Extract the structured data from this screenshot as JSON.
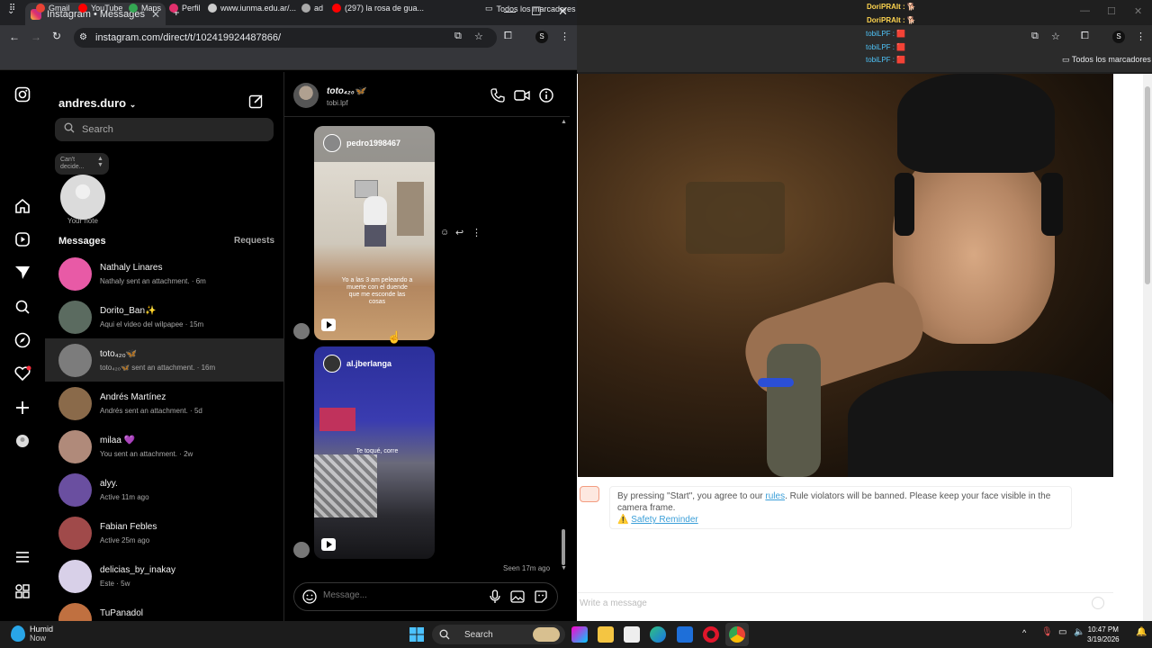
{
  "browser_left": {
    "tab_title": "Instagram • Messages",
    "url": "instagram.com/direct/t/102419924487866/",
    "bookmarks": [
      "Gmail",
      "YouTube",
      "Maps",
      "Perfil",
      "www.iunma.edu.ar/...",
      "ad",
      "(297) la rosa de gua...",
      "Todos los marcadores"
    ]
  },
  "instagram": {
    "account": "andres.duro",
    "search_placeholder": "Search",
    "note_bubble": "Can't decide...",
    "note_label": "Your note",
    "messages_header": "Messages",
    "requests_label": "Requests",
    "conversations": [
      {
        "name": "Nathaly Linares",
        "preview": "Nathaly sent an attachment. · 6m",
        "color": "#e85aa6"
      },
      {
        "name": "Dorito_Ban✨",
        "preview": "Aqui el video del wilpapee · 15m",
        "color": "#5b6b60"
      },
      {
        "name": "toto₄₂₀🦋",
        "preview": "toto₄₂₀🦋 sent an attachment. · 16m",
        "color": "#7c7c7c"
      },
      {
        "name": "Andrés Martínez",
        "preview": "Andrés sent an attachment. · 5d",
        "color": "#8a6a4a"
      },
      {
        "name": "milaa 💜",
        "preview": "You sent an attachment. · 2w",
        "color": "#b08a7a"
      },
      {
        "name": "alyy.",
        "preview": "Active 11m ago",
        "color": "#6a4fa0"
      },
      {
        "name": "Fabian Febles",
        "preview": "Active 25m ago",
        "color": "#a04a4a"
      },
      {
        "name": "delicias_by_inakay",
        "preview": "Este · 5w",
        "color": "#d8d0e8"
      },
      {
        "name": "TuPanadol",
        "preview": "",
        "color": "#c07040"
      }
    ],
    "chat": {
      "name": "toto₄₂₀🦋",
      "handle": "tobi.lpf",
      "reel1_user": "pedro1998467",
      "reel1_caption": "Yo a las 3 am peleando a muerte con el duende que me esconde las cosas",
      "reel2_user": "al.jberlanga",
      "reel2_caption": "Te toqué, corre",
      "seen": "Seen 17m ago",
      "input_placeholder": "Message..."
    }
  },
  "browser_right": {
    "overlay": [
      "DoriPRAIt : 🐕",
      "DoriPRAIt : 🐕",
      "tobiLPF : 🟥",
      "tobiLPF : 🟥",
      "tobiLPF : 🟥"
    ],
    "bookmark": "Todos los marcadores",
    "notice_pre": "By pressing \"Start\", you agree to our ",
    "notice_link": "rules",
    "notice_post": ". Rule violators will be banned. Please keep your face visible in the camera frame.",
    "safety": "Safety Reminder",
    "write_placeholder": "Write a message"
  },
  "taskbar": {
    "weather_title": "Humid",
    "weather_sub": "Now",
    "search": "Search",
    "time": "10:47 PM",
    "date": "3/19/2026"
  }
}
